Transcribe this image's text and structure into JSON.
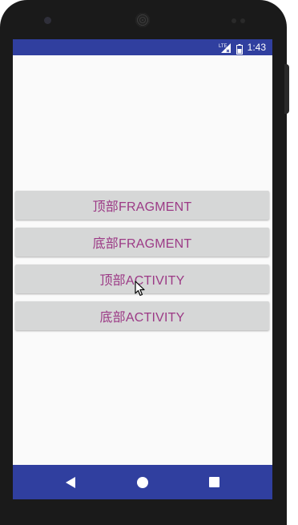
{
  "status_bar": {
    "network": "LTE",
    "time": "1:43"
  },
  "buttons": [
    {
      "label": "顶部FRAGMENT"
    },
    {
      "label": "底部FRAGMENT"
    },
    {
      "label": "顶部ACTIVITY"
    },
    {
      "label": "底部ACTIVITY"
    }
  ],
  "icons": {
    "back": "back-icon",
    "home": "home-icon",
    "recents": "recents-icon",
    "cursor": "mouse-pointer-icon"
  },
  "colors": {
    "primary_dark": "#303f9f",
    "button_text": "#9c3a86",
    "button_bg": "#d6d7d7",
    "background": "#fafafa"
  }
}
